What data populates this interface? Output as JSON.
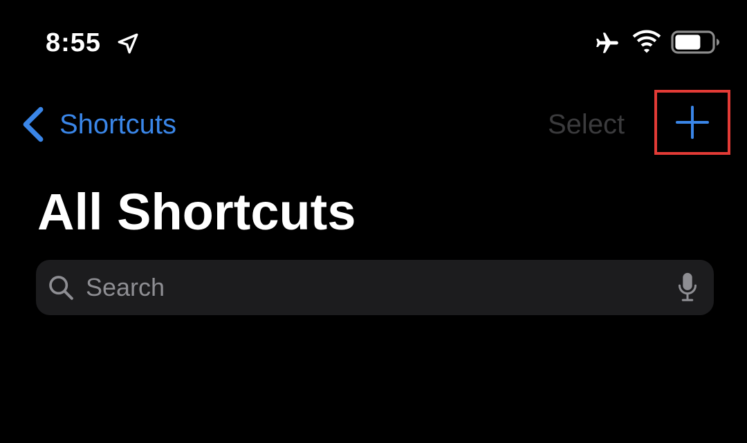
{
  "status_bar": {
    "time": "8:55",
    "icons": [
      "location-arrow-icon",
      "airplane-icon",
      "wifi-icon",
      "battery-icon"
    ]
  },
  "nav": {
    "back_label": "Shortcuts",
    "select_label": "Select",
    "add_icon": "plus-icon",
    "highlight_color": "#e33b36"
  },
  "page": {
    "title": "All Shortcuts"
  },
  "search": {
    "placeholder": "Search",
    "value": "",
    "icon": "search-icon",
    "mic_icon": "microphone-icon"
  },
  "colors": {
    "background": "#000000",
    "accent": "#3a86e8",
    "disabled": "#3b3b3d",
    "search_bg": "#1c1c1e",
    "placeholder": "#8e8e93"
  }
}
